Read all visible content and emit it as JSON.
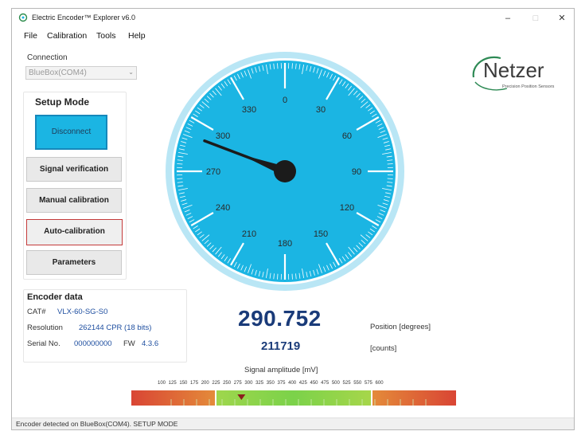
{
  "window": {
    "title": "Electric Encoder™ Explorer v6.0",
    "minimize": "–",
    "maximize": "□",
    "close": "✕"
  },
  "menu": [
    "File",
    "Calibration",
    "Tools",
    "Help"
  ],
  "connection": {
    "label": "Connection",
    "value": "BlueBox(COM4)"
  },
  "setup": {
    "title": "Setup Mode",
    "buttons": {
      "disconnect": "Disconnect",
      "signal": "Signal verification",
      "manual": "Manual calibration",
      "auto": "Auto-calibration",
      "params": "Parameters"
    }
  },
  "logo": {
    "name": "Netzer",
    "tagline": "Precision Position Sensors"
  },
  "gauge": {
    "labels": [
      "0",
      "30",
      "60",
      "90",
      "120",
      "150",
      "180",
      "210",
      "240",
      "270",
      "300",
      "330"
    ],
    "needle_degrees": 290.752,
    "colors": {
      "face": "#1bb5e3",
      "rim": "#b9e6f5",
      "needle": "#1b1b1b"
    }
  },
  "encoder": {
    "title": "Encoder data",
    "cat_label": "CAT#",
    "cat_value": "VLX-60-SG-S0",
    "res_label": "Resolution",
    "res_value": "262144 CPR (18 bits)",
    "serial_label": "Serial No.",
    "serial_value": "000000000",
    "fw_label": "FW",
    "fw_value": "4.3.6"
  },
  "position": {
    "degrees": "290.752",
    "counts": "211719",
    "degrees_label": "Position [degrees]",
    "counts_label": "[counts]"
  },
  "signal": {
    "title": "Signal amplitude [mV]",
    "ticks": "100 125 150 175 200 225 250 275 300 325 350 375 400 425 450 475 500 525 550 575 600",
    "marker_mv": 238,
    "colors": {
      "low": "#d94534",
      "ok": "#82d24a",
      "high": "#d94534"
    }
  },
  "status": "Encoder detected on BlueBox(COM4). SETUP MODE"
}
